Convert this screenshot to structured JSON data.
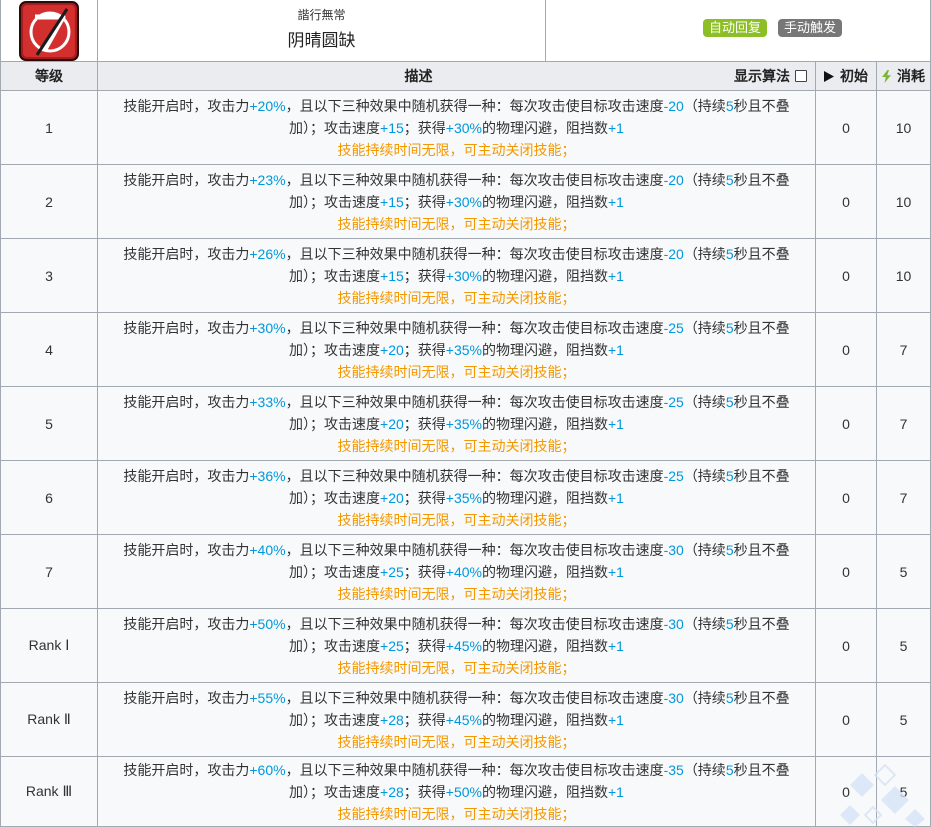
{
  "skill": {
    "icon": "skill-icon",
    "subtitle": "諧行無常",
    "name": "阴晴圆缺",
    "badges": [
      {
        "label": "自动回复",
        "color": "#8cbf26"
      },
      {
        "label": "手动触发",
        "color": "#777777"
      }
    ]
  },
  "header": {
    "level": "等级",
    "description": "描述",
    "show_formula": "显示算法",
    "show_formula_checked": false,
    "initial_icon": "play-icon",
    "initial": "初始",
    "cost_icon": "lightning-icon",
    "cost": "消耗"
  },
  "desc_template": {
    "s1": "技能开启时，攻击力",
    "s2": "，且以下三种效果中随机获得一种：每次攻击使目标攻击速度",
    "s3": "（持续",
    "s4": "秒且不叠",
    "s5": "加）；攻击速度",
    "s6": "；获得",
    "s7": "的物理闪避，阻挡数",
    "note": "技能持续时间无限，可主动关闭技能；"
  },
  "colors": {
    "highlight": "#0098dc",
    "note": "#f49800",
    "header_bg": "#eaecf0",
    "cost_icon": "#7cb82f"
  },
  "rows": [
    {
      "level": "1",
      "atk": "+20%",
      "enemy_aspd": "-20",
      "duration": "5",
      "aspd": "+15",
      "dodge": "+30%",
      "block": "+1",
      "initial": "0",
      "cost": "10"
    },
    {
      "level": "2",
      "atk": "+23%",
      "enemy_aspd": "-20",
      "duration": "5",
      "aspd": "+15",
      "dodge": "+30%",
      "block": "+1",
      "initial": "0",
      "cost": "10"
    },
    {
      "level": "3",
      "atk": "+26%",
      "enemy_aspd": "-20",
      "duration": "5",
      "aspd": "+15",
      "dodge": "+30%",
      "block": "+1",
      "initial": "0",
      "cost": "10"
    },
    {
      "level": "4",
      "atk": "+30%",
      "enemy_aspd": "-25",
      "duration": "5",
      "aspd": "+20",
      "dodge": "+35%",
      "block": "+1",
      "initial": "0",
      "cost": "7"
    },
    {
      "level": "5",
      "atk": "+33%",
      "enemy_aspd": "-25",
      "duration": "5",
      "aspd": "+20",
      "dodge": "+35%",
      "block": "+1",
      "initial": "0",
      "cost": "7"
    },
    {
      "level": "6",
      "atk": "+36%",
      "enemy_aspd": "-25",
      "duration": "5",
      "aspd": "+20",
      "dodge": "+35%",
      "block": "+1",
      "initial": "0",
      "cost": "7"
    },
    {
      "level": "7",
      "atk": "+40%",
      "enemy_aspd": "-30",
      "duration": "5",
      "aspd": "+25",
      "dodge": "+40%",
      "block": "+1",
      "initial": "0",
      "cost": "5"
    },
    {
      "level": "Rank Ⅰ",
      "atk": "+50%",
      "enemy_aspd": "-30",
      "duration": "5",
      "aspd": "+25",
      "dodge": "+45%",
      "block": "+1",
      "initial": "0",
      "cost": "5"
    },
    {
      "level": "Rank Ⅱ",
      "atk": "+55%",
      "enemy_aspd": "-30",
      "duration": "5",
      "aspd": "+28",
      "dodge": "+45%",
      "block": "+1",
      "initial": "0",
      "cost": "5"
    },
    {
      "level": "Rank Ⅲ",
      "atk": "+60%",
      "enemy_aspd": "-35",
      "duration": "5",
      "aspd": "+28",
      "dodge": "+50%",
      "block": "+1",
      "initial": "0",
      "cost": "5"
    }
  ]
}
